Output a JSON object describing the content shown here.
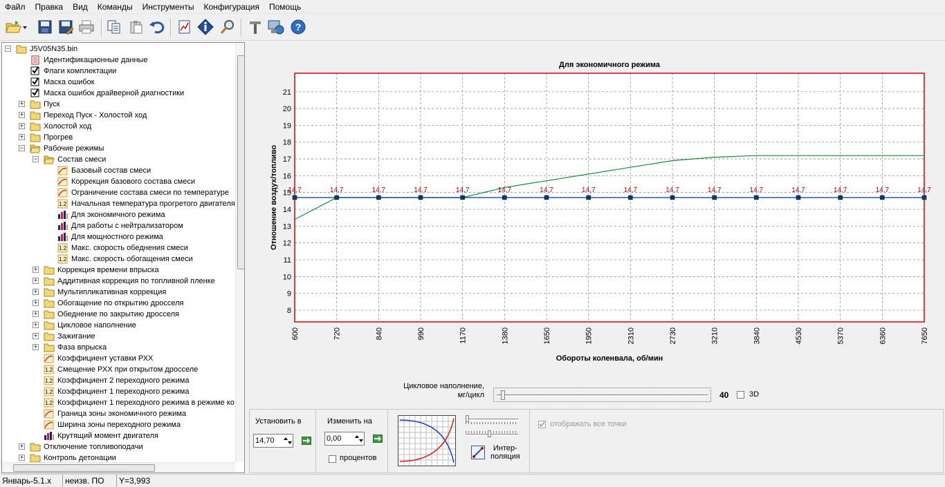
{
  "menu": [
    "Файл",
    "Правка",
    "Вид",
    "Команды",
    "Инструменты",
    "Конфигурация",
    "Помощь"
  ],
  "toolbar": {
    "icons": [
      "open-folder-icon",
      "save-icon",
      "save-as-icon",
      "print-icon",
      "copy-icon",
      "paste-icon",
      "undo-icon",
      "chart-icon",
      "info-icon",
      "search-icon",
      "tools-icon",
      "connect-icon",
      "help-icon"
    ]
  },
  "tree": {
    "root": "J5V05N35.bin",
    "items": [
      {
        "label": "Идентификационные данные",
        "level": 1,
        "icon": "doc-red-icon",
        "exp": ""
      },
      {
        "label": "Флаги комплектации",
        "level": 1,
        "icon": "checkbox-icon",
        "exp": ""
      },
      {
        "label": "Маска ошибок",
        "level": 1,
        "icon": "checkbox-icon",
        "exp": ""
      },
      {
        "label": "Маска ошибок драйверной диагностики",
        "level": 1,
        "icon": "checkbox-icon",
        "exp": ""
      },
      {
        "label": "Пуск",
        "level": 1,
        "icon": "folder-icon",
        "exp": "+"
      },
      {
        "label": "Переход Пуск - Холостой ход",
        "level": 1,
        "icon": "folder-icon",
        "exp": "+"
      },
      {
        "label": "Холостой ход",
        "level": 1,
        "icon": "folder-icon",
        "exp": "+"
      },
      {
        "label": "Прогрев",
        "level": 1,
        "icon": "folder-icon",
        "exp": "+"
      },
      {
        "label": "Рабочие режимы",
        "level": 1,
        "icon": "folder-open-icon",
        "exp": "-"
      },
      {
        "label": "Состав смеси",
        "level": 2,
        "icon": "folder-open-icon",
        "exp": "-"
      },
      {
        "label": "Базовый состав смеси",
        "level": 3,
        "icon": "curve-icon",
        "exp": ""
      },
      {
        "label": "Коррекция базового состава смеси",
        "level": 3,
        "icon": "curve-icon",
        "exp": ""
      },
      {
        "label": "Ограничение состава смеси по температуре",
        "level": 3,
        "icon": "curve-icon",
        "exp": ""
      },
      {
        "label": "Начальная температура прогретого двигателя",
        "level": 3,
        "icon": "const-icon",
        "exp": ""
      },
      {
        "label": "Для экономичного режима",
        "level": 3,
        "icon": "bars-icon",
        "exp": ""
      },
      {
        "label": "Для работы с нейтрализатором",
        "level": 3,
        "icon": "bars-icon",
        "exp": ""
      },
      {
        "label": "Для мощностного режима",
        "level": 3,
        "icon": "bars-icon",
        "exp": ""
      },
      {
        "label": "Макс. скорость обеднения смеси",
        "level": 3,
        "icon": "const-icon",
        "exp": ""
      },
      {
        "label": "Макс. скорость обогащения смеси",
        "level": 3,
        "icon": "const-icon",
        "exp": ""
      },
      {
        "label": "Коррекция времени впрыска",
        "level": 2,
        "icon": "folder-icon",
        "exp": "+"
      },
      {
        "label": "Аддитивная коррекция по топливной пленке",
        "level": 2,
        "icon": "folder-icon",
        "exp": "+"
      },
      {
        "label": "Мультипликативная коррекция",
        "level": 2,
        "icon": "folder-icon",
        "exp": "+"
      },
      {
        "label": "Обогащение по открытию дросселя",
        "level": 2,
        "icon": "folder-icon",
        "exp": "+"
      },
      {
        "label": "Обеднение по закрытию дросселя",
        "level": 2,
        "icon": "folder-icon",
        "exp": "+"
      },
      {
        "label": "Цикловое наполнение",
        "level": 2,
        "icon": "folder-icon",
        "exp": "+"
      },
      {
        "label": "Зажигание",
        "level": 2,
        "icon": "folder-icon",
        "exp": "+"
      },
      {
        "label": "Фаза впрыска",
        "level": 2,
        "icon": "folder-icon",
        "exp": "+"
      },
      {
        "label": "Коэффициент уставки РХХ",
        "level": 2,
        "icon": "curve-icon",
        "exp": ""
      },
      {
        "label": "Смещение РХХ при открытом дросселе",
        "level": 2,
        "icon": "const-icon",
        "exp": ""
      },
      {
        "label": "Коэффициент 2 переходного режима",
        "level": 2,
        "icon": "const-icon",
        "exp": ""
      },
      {
        "label": "Коэффициент 1 переходного режима",
        "level": 2,
        "icon": "const-icon",
        "exp": ""
      },
      {
        "label": "Коэффициент 1 переходного режима в режиме ко",
        "level": 2,
        "icon": "const-icon",
        "exp": ""
      },
      {
        "label": "Граница зоны экономичного режима",
        "level": 2,
        "icon": "curve-icon",
        "exp": ""
      },
      {
        "label": "Ширина зоны переходного режима",
        "level": 2,
        "icon": "curve-icon",
        "exp": ""
      },
      {
        "label": "Крутящий момент двигателя",
        "level": 2,
        "icon": "bars-icon",
        "exp": ""
      },
      {
        "label": "Отключение топливоподачи",
        "level": 1,
        "icon": "folder-icon",
        "exp": "+"
      },
      {
        "label": "Контроль детонации",
        "level": 1,
        "icon": "folder-icon",
        "exp": "+"
      }
    ]
  },
  "chart_data": {
    "type": "line",
    "title": "Для экономичного режима",
    "xlabel": "Обороты коленвала, об/мин",
    "ylabel": "Отношение воздух/топливо",
    "categories": [
      "600",
      "720",
      "840",
      "990",
      "1170",
      "1380",
      "1650",
      "1950",
      "2310",
      "2730",
      "3210",
      "3840",
      "4530",
      "5370",
      "6360",
      "7650"
    ],
    "ylim": [
      7.3,
      22.1
    ],
    "yticks": [
      8,
      9,
      10,
      11,
      12,
      13,
      14,
      15,
      16,
      17,
      18,
      19,
      20,
      21
    ],
    "grid": true,
    "series": [
      {
        "values": [
          14.7,
          14.7,
          14.7,
          14.7,
          14.7,
          14.7,
          14.7,
          14.7,
          14.7,
          14.7,
          14.7,
          14.7,
          14.7,
          14.7,
          14.7,
          14.7
        ],
        "color": "#00308f",
        "labels": [
          "14,7",
          "14,7",
          "14,7",
          "14,7",
          "14,7",
          "14,7",
          "14,7",
          "14,7",
          "14,7",
          "14,7",
          "14,7",
          "14,7",
          "14,7",
          "14,7",
          "14,7",
          "14,7"
        ]
      },
      {
        "values": [
          13.4,
          14.7,
          14.7,
          14.7,
          14.7,
          15.3,
          15.7,
          16.1,
          16.5,
          16.9,
          17.1,
          17.2,
          17.2,
          17.2,
          17.2,
          17.2
        ],
        "color": "#108a3a"
      }
    ],
    "frame_color": "#d40000"
  },
  "controls": {
    "cyclic_label_1": "Цикловое наполнение,",
    "cyclic_label_2": "мг/цикл",
    "slider_value": "40",
    "label_3d": "3D",
    "set_label": "Установить в",
    "set_value": "14,70",
    "change_label": "Изменить на",
    "change_value": "0,00",
    "percent_label": "процентов",
    "interp_label_1": "Интер-",
    "interp_label_2": "поляция",
    "show_all_label": "отображать все точки"
  },
  "status": {
    "app": "Январь-5.1.х",
    "software": "неизв. ПО",
    "coord": "Y=3,993"
  }
}
